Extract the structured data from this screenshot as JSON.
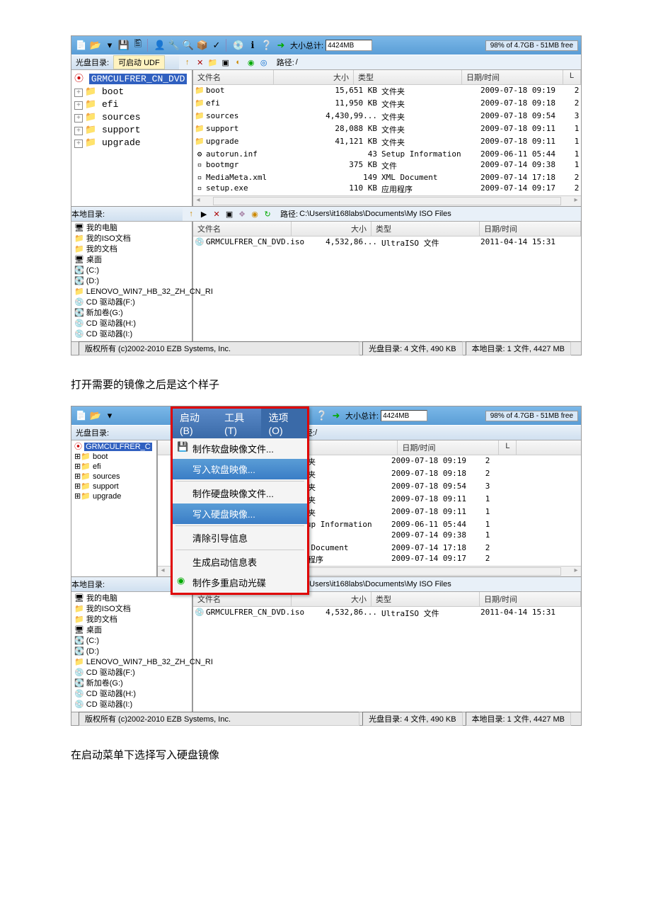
{
  "doc": {
    "caption1": "打开需要的镜像之后是这个样子",
    "caption2": "在启动菜单下选择写入硬盘镜像"
  },
  "app": {
    "total_label": "大小总计:",
    "total_value": "4424MB",
    "free_status": "98% of 4.7GB - 51MB free",
    "disc_dir_label": "光盘目录:",
    "bootable": "可启动 UDF",
    "path_label": "路径:",
    "path_value": "/",
    "local_dir_label": "本地目录:",
    "local_path_label": "路径:",
    "local_path_value": "C:\\Users\\it168labs\\Documents\\My ISO Files",
    "cols": {
      "name": "文件名",
      "size": "大小",
      "type": "类型",
      "date": "日期/时间",
      "x": "L"
    },
    "tree1": {
      "root": "GRMCULFRER_CN_DVD",
      "items": [
        "boot",
        "efi",
        "sources",
        "support",
        "upgrade"
      ]
    },
    "tree1_small": {
      "root": "GRMCULFRER_C",
      "items": [
        "boot",
        "efi",
        "sources",
        "support",
        "upgrade"
      ]
    },
    "rows": [
      {
        "ic": "📁",
        "nm": "boot",
        "sz": "15,651 KB",
        "tp": "文件夹",
        "dt": "2009-07-18 09:19",
        "x": "2"
      },
      {
        "ic": "📁",
        "nm": "efi",
        "sz": "11,950 KB",
        "tp": "文件夹",
        "dt": "2009-07-18 09:18",
        "x": "2"
      },
      {
        "ic": "📁",
        "nm": "sources",
        "sz": "4,430,99...",
        "tp": "文件夹",
        "dt": "2009-07-18 09:54",
        "x": "3"
      },
      {
        "ic": "📁",
        "nm": "support",
        "sz": "28,088 KB",
        "tp": "文件夹",
        "dt": "2009-07-18 09:11",
        "x": "1"
      },
      {
        "ic": "📁",
        "nm": "upgrade",
        "sz": "41,121 KB",
        "tp": "文件夹",
        "dt": "2009-07-18 09:11",
        "x": "1"
      },
      {
        "ic": "⚙",
        "nm": "autorun.inf",
        "sz": "43",
        "tp": "Setup Information",
        "dt": "2009-06-11 05:44",
        "x": "1"
      },
      {
        "ic": "▫",
        "nm": "bootmgr",
        "sz": "375 KB",
        "tp": "文件",
        "dt": "2009-07-14 09:38",
        "x": "1"
      },
      {
        "ic": "▫",
        "nm": "MediaMeta.xml",
        "sz": "149",
        "tp": "XML Document",
        "dt": "2009-07-14 17:18",
        "x": "2"
      },
      {
        "ic": "▫",
        "nm": "setup.exe",
        "sz": "110 KB",
        "tp": "应用程序",
        "dt": "2009-07-14 09:17",
        "x": "2"
      }
    ],
    "local_rows": [
      {
        "ic": "💿",
        "nm": "GRMCULFRER_CN_DVD.iso",
        "sz": "4,532,86...",
        "tp": "UltraISO 文件",
        "dt": "2011-04-14 15:31",
        "x": ""
      }
    ],
    "local_tree": [
      "🖥 我的电脑",
      "  📁 我的ISO文档",
      "  📁 我的文档",
      "  🖥 桌面",
      "  💽 (C:)",
      "  💽 (D:)",
      "  📁 LENOVO_WIN7_HB_32_ZH_CN_RI",
      "  💿 CD 驱动器(F:)",
      "  💽 新加卷(G:)",
      "  💿 CD 驱动器(H:)",
      "  💿 CD 驱动器(I:)"
    ],
    "status": {
      "copyright": "版权所有 (c)2002-2010 EZB Systems, Inc.",
      "disc": "光盘目录: 4 文件, 490 KB",
      "local": "本地目录: 1 文件, 4427 MB"
    }
  },
  "menu": {
    "top": {
      "boot": "启动(B)",
      "tools": "工具(T)",
      "options": "选项(O)"
    },
    "items": {
      "make_floppy": "制作软盘映像文件...",
      "write_floppy": "写入软盘映像...",
      "make_hdd": "制作硬盘映像文件...",
      "write_hdd": "写入硬盘映像...",
      "clear_boot": "清除引导信息",
      "gen_boot": "生成启动信息表",
      "multi_boot": "制作多重启动光碟"
    }
  }
}
